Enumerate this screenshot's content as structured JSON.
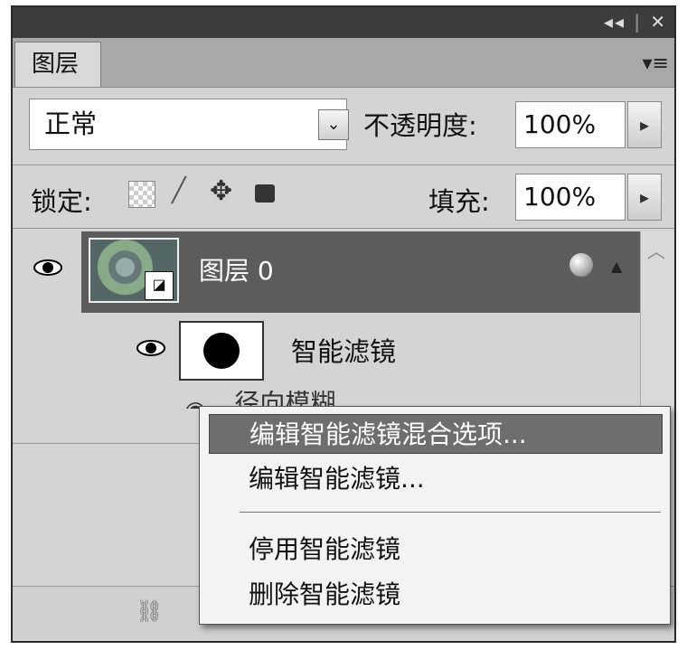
{
  "window": {
    "collapse_icon": "◂◂",
    "close_icon": "✕"
  },
  "panel": {
    "tab_label": "图层",
    "menu_icon": "▾≡"
  },
  "blend": {
    "mode": "正常",
    "opacity_label": "不透明度:",
    "opacity_value": "100%"
  },
  "lock": {
    "label": "锁定:",
    "fill_label": "填充:",
    "fill_value": "100%"
  },
  "layers": {
    "layer0_name": "图层 0",
    "smart_filters_label": "智能滤镜",
    "filter_partial": "径向模糊"
  },
  "context_menu": {
    "items": [
      "编辑智能滤镜混合选项...",
      "编辑智能滤镜...",
      "停用智能滤镜",
      "删除智能滤镜"
    ]
  },
  "icons": {
    "eye": "eye-icon",
    "link": "link-icon",
    "step": "▸",
    "dropdown": "⌄"
  }
}
